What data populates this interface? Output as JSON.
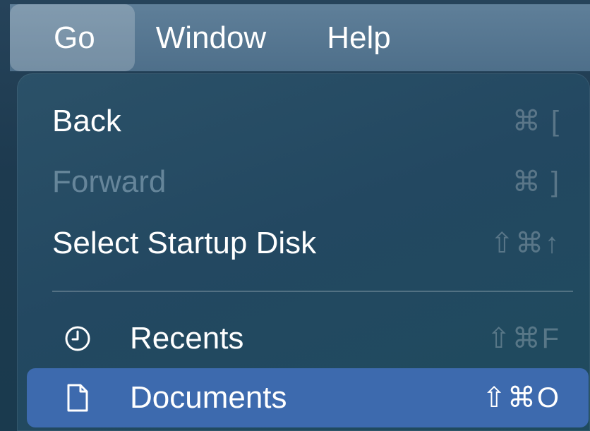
{
  "menubar": {
    "items": [
      {
        "label": "Go"
      },
      {
        "label": "Window"
      },
      {
        "label": "Help"
      }
    ]
  },
  "go_menu": {
    "items": [
      {
        "label": "Back",
        "shortcut": "⌘ ["
      },
      {
        "label": "Forward",
        "shortcut": "⌘ ]",
        "enabled": false
      },
      {
        "label": "Select Startup Disk",
        "shortcut": "⇧⌘↑"
      },
      {
        "label": "Recents",
        "shortcut": "⇧⌘F",
        "icon": "clock-icon"
      },
      {
        "label": "Documents",
        "shortcut": "⇧⌘O",
        "icon": "document-icon",
        "highlighted": true
      }
    ]
  },
  "colors": {
    "selection": "#3d6aae",
    "menu_bg": "#234861",
    "menubar_bg": "#567690"
  }
}
